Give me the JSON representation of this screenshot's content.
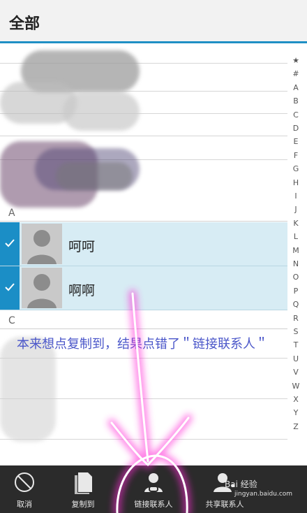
{
  "header": {
    "title": "全部"
  },
  "sections": {
    "a": "A",
    "c": "C"
  },
  "contacts": [
    {
      "name": "呵呵",
      "selected": true
    },
    {
      "name": "啊啊",
      "selected": true
    }
  ],
  "index_letters": [
    "★",
    "#",
    "A",
    "B",
    "C",
    "D",
    "E",
    "F",
    "G",
    "H",
    "I",
    "J",
    "K",
    "L",
    "M",
    "N",
    "O",
    "P",
    "Q",
    "R",
    "S",
    "T",
    "U",
    "V",
    "W",
    "X",
    "Y",
    "Z"
  ],
  "annotation": "本来想点复制到，结果点错了＂链接联系人＂",
  "toolbar": {
    "cancel_label": "取消",
    "copy_label": "复制到",
    "link_label": "链接联系人",
    "share_label": "共享联系人"
  },
  "watermark": {
    "brand": "Bai 经验",
    "url": "jingyan.baidu.com"
  },
  "colors": {
    "accent": "#1b8ec6",
    "selected_row": "#d7ecf4",
    "annotation": "#4a56c9",
    "highlight": "#ff2bd6",
    "toolbar": "#2b2b2b"
  }
}
